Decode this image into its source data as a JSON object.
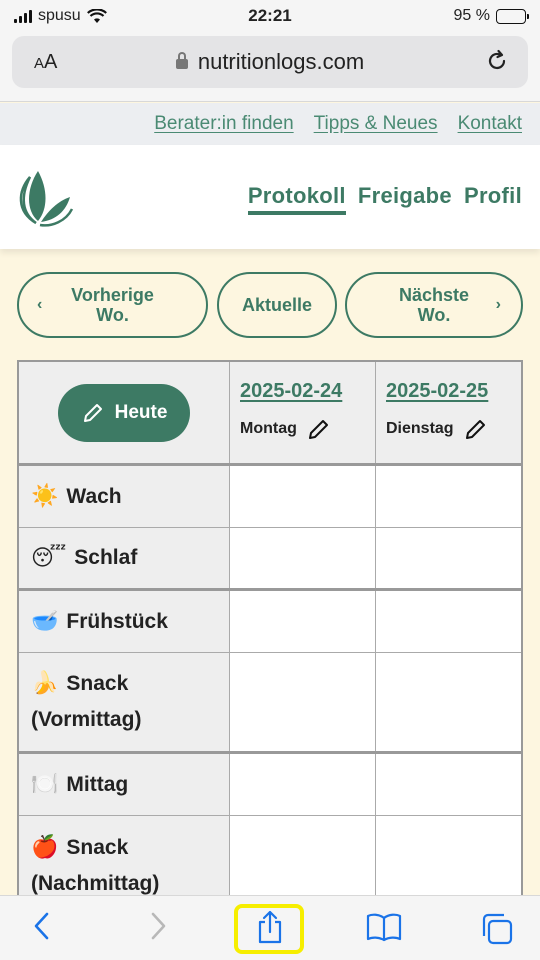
{
  "status": {
    "carrier": "spusu",
    "time": "22:21",
    "battery": "95 %",
    "battery_level": 0.95
  },
  "browser": {
    "text_size": "AA",
    "url": "nutritionlogs.com"
  },
  "top_links": [
    "Berater:in finden",
    "Tipps & Neues",
    "Kontakt"
  ],
  "nav": {
    "protokoll": "Protokoll",
    "freigabe": "Freigabe",
    "profil": "Profil",
    "active": "Protokoll"
  },
  "week_nav": {
    "prev_line1": "Vorherige",
    "prev_line2": "Wo.",
    "current": "Aktuelle",
    "next_line1": "Nächste",
    "next_line2": "Wo."
  },
  "table": {
    "today_label": "Heute",
    "days": [
      {
        "date": "2025-02-24",
        "weekday": "Montag"
      },
      {
        "date": "2025-02-25",
        "weekday": "Dienstag"
      }
    ],
    "rows": [
      {
        "icon": "sun-emoji",
        "emoji": "☀️",
        "label": "Wach"
      },
      {
        "icon": "sleeping-face-emoji",
        "emoji": "😴",
        "label": "Schlaf"
      },
      {
        "icon": "bowl-emoji",
        "emoji": "🥣",
        "label": "Frühstück"
      },
      {
        "icon": "banana-emoji",
        "emoji": "🍌",
        "label": "Snack",
        "sub": "(Vormittag)"
      },
      {
        "icon": "plate-emoji",
        "emoji": "🍽️",
        "label": "Mittag"
      },
      {
        "icon": "apple-emoji",
        "emoji": "🍎",
        "label": "Snack",
        "sub": "(Nachmittag)"
      }
    ]
  },
  "colors": {
    "accent": "#3d7a64",
    "link": "#4a8a73",
    "background": "#fdf6e0",
    "highlight": "#f6ee00"
  }
}
